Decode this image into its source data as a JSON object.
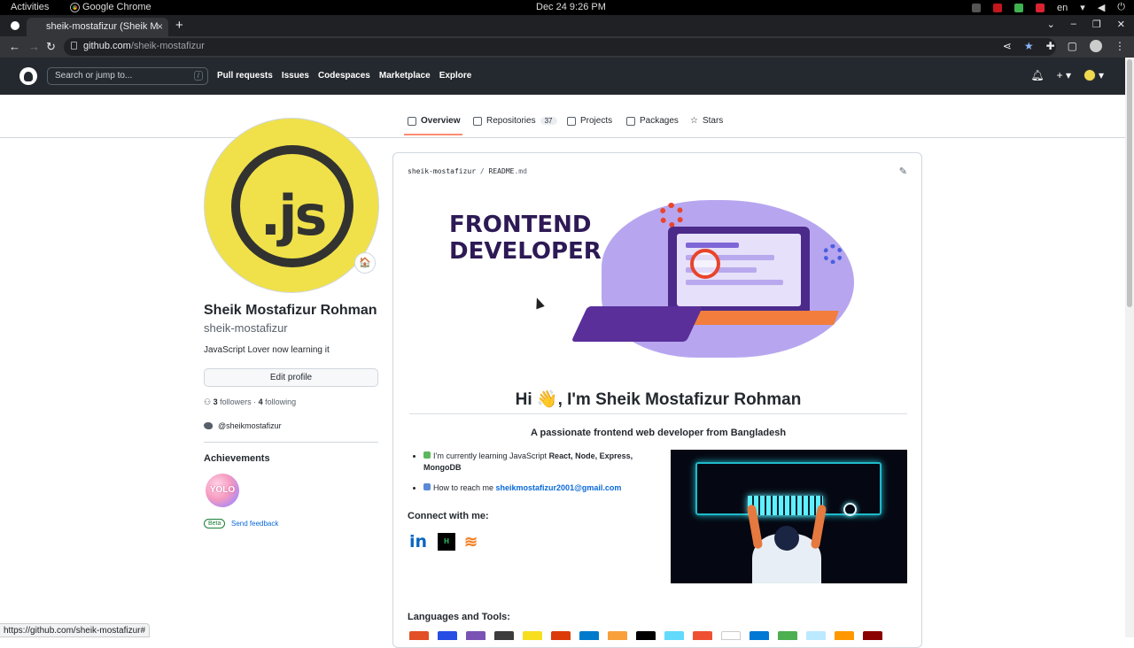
{
  "system_bar": {
    "activities": "Activities",
    "app_name": "Google Chrome",
    "clock": "Dec 24  9:26 PM",
    "language": "en"
  },
  "browser": {
    "tab_title": "sheik-mostafizur (Sheik M",
    "url_host": "github.com",
    "url_path": "/sheik-mostafizur",
    "status_url": "https://github.com/sheik-mostafizur#"
  },
  "github_header": {
    "search_placeholder": "Search or jump to...",
    "search_key": "/",
    "nav": [
      "Pull requests",
      "Issues",
      "Codespaces",
      "Marketplace",
      "Explore"
    ],
    "plus_label": "+"
  },
  "profile_tabs": [
    {
      "label": "Overview",
      "icon": "book-icon",
      "active": true
    },
    {
      "label": "Repositories",
      "icon": "repo-icon",
      "count": "37"
    },
    {
      "label": "Projects",
      "icon": "table-icon"
    },
    {
      "label": "Packages",
      "icon": "package-icon"
    },
    {
      "label": "Stars",
      "icon": "star-icon"
    }
  ],
  "profile": {
    "avatar_text": ".js",
    "status_emoji": "🏠",
    "full_name": "Sheik Mostafizur Rohman",
    "username": "sheik-mostafizur",
    "bio": "JavaScript Lover now learning it",
    "edit_button": "Edit profile",
    "followers_count": "3",
    "followers_label": "followers",
    "following_count": "4",
    "following_label": "following",
    "twitter": "@sheikmostafizur",
    "achievements_heading": "Achievements",
    "achievement_badge": "YOLO",
    "beta_label": "Beta",
    "feedback_link": "Send feedback"
  },
  "readme": {
    "owner": "sheik-mostafizur",
    "separator": "/",
    "file_name": "README",
    "file_ext": ".md",
    "hero_title_line1": "FRONTEND",
    "hero_title_line2": "DEVELOPER",
    "greeting": "Hi 👋, I'm Sheik Mostafizur Rohman",
    "tagline": "A passionate frontend web developer from Bangladesh",
    "bullet1_prefix": "I’m currently learning JavaScript ",
    "bullet1_bold": "React, Node, Express, MongoDB",
    "bullet2_prefix": "How to reach me ",
    "bullet2_email": "sheikmostafizur2001@gmail.com",
    "connect_heading": "Connect with me:",
    "social": {
      "linkedin": "in",
      "hackerrank": "H"
    },
    "languages_heading": "Languages and Tools:"
  },
  "colors": {
    "github_header_bg": "#24292f",
    "link": "#0969da",
    "active_tab_underline": "#fd8c73",
    "avatar_yellow": "#f0e14a"
  },
  "tool_icon_colors": [
    "#e34f26",
    "#264de4",
    "#7952b3",
    "#3c3c3c",
    "#f7df1e",
    "#dd3a0a",
    "#007acc",
    "#f9a03c",
    "#000000",
    "#61dafb",
    "#f05032",
    "#ffffff",
    "#0078d4",
    "#4caf50",
    "#bbe9ff",
    "#ff9800",
    "#8b0000"
  ]
}
